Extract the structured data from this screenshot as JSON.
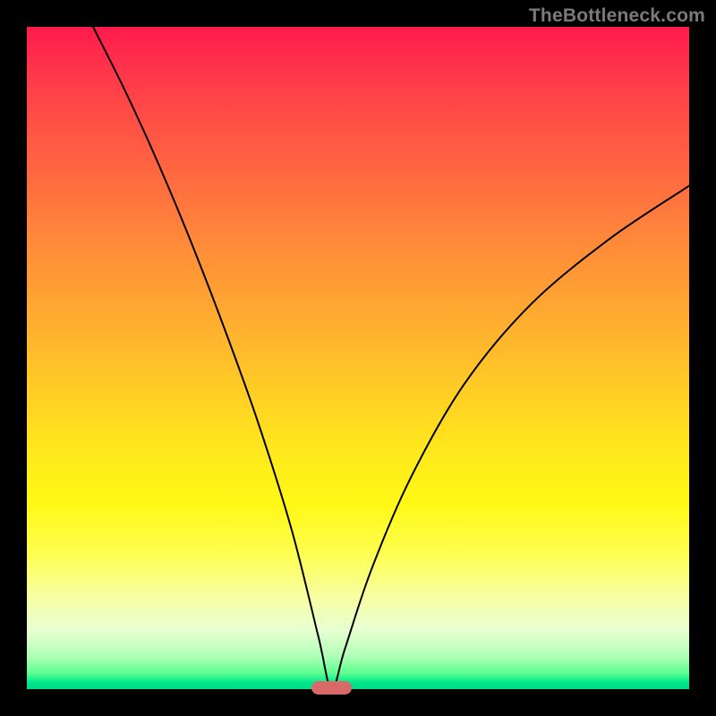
{
  "watermark": "TheBottleneck.com",
  "colors": {
    "frame": "#000000",
    "curve": "#000000",
    "marker": "#d86a6a",
    "gradient_top": "#ff1a4d",
    "gradient_bottom": "#00d98a"
  },
  "chart_data": {
    "type": "line",
    "title": "",
    "xlabel": "",
    "ylabel": "",
    "xlim": [
      0,
      100
    ],
    "ylim": [
      0,
      100
    ],
    "grid": false,
    "legend": false,
    "notes": "Heat-gradient background (red high → green low). Single V-shaped black curve dipping to ~0 near x≈46. Small rounded marker at the trough.",
    "series": [
      {
        "name": "curve",
        "x": [
          10,
          15,
          20,
          25,
          30,
          35,
          40,
          44,
          46,
          48,
          52,
          58,
          66,
          76,
          88,
          100
        ],
        "values": [
          100,
          90,
          79,
          67,
          54,
          40,
          24,
          8,
          0,
          6,
          18,
          32,
          46,
          58,
          68,
          76
        ]
      }
    ],
    "marker": {
      "x": 46,
      "y": 0,
      "width_pct": 6
    }
  }
}
